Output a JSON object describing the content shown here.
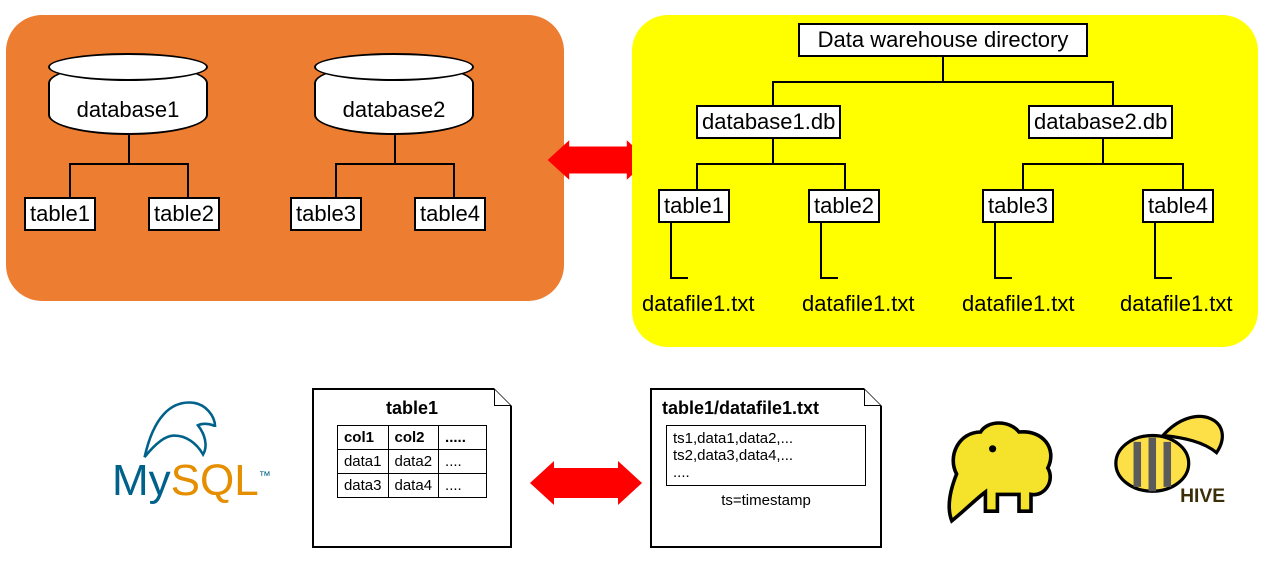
{
  "mysqlPanel": {
    "db1": {
      "label": "database1",
      "tables": [
        "table1",
        "table2"
      ]
    },
    "db2": {
      "label": "database2",
      "tables": [
        "table3",
        "table4"
      ]
    }
  },
  "warehousePanel": {
    "root": "Data warehouse directory",
    "dbs": [
      {
        "label": "database1.db",
        "tables": [
          "table1",
          "table2"
        ],
        "files": [
          "datafile1.txt",
          "datafile1.txt"
        ]
      },
      {
        "label": "database2.db",
        "tables": [
          "table3",
          "table4"
        ],
        "files": [
          "datafile1.txt",
          "datafile1.txt"
        ]
      }
    ]
  },
  "mysqlDoc": {
    "title": "table1",
    "header": [
      "col1",
      "col2",
      "....."
    ],
    "rows": [
      [
        "data1",
        "data2",
        "...."
      ],
      [
        "data3",
        "data4",
        "...."
      ]
    ]
  },
  "hiveDoc": {
    "title": "table1/datafile1.txt",
    "lines": [
      "ts1,data1,data2,...",
      "ts2,data3,data4,...",
      "...."
    ],
    "note": "ts=timestamp"
  },
  "logos": {
    "mysql_my": "My",
    "mysql_sql": "SQL",
    "mysql_tm": "™",
    "hive_label": "HIVE"
  }
}
